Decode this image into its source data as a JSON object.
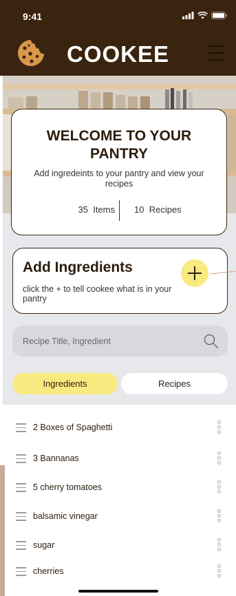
{
  "status_bar": {
    "time": "9:41"
  },
  "header": {
    "title": "COOKEE"
  },
  "welcome": {
    "title": "WELCOME TO YOUR PANTRY",
    "subtitle": "Add ingredeints to your pantry and view your recipes",
    "items_count": "35",
    "items_label": "Items",
    "recipes_count": "10",
    "recipes_label": "Recipes"
  },
  "add_ingredients": {
    "title": "Add Ingredients",
    "subtitle": "click the + to tell cookee what is in your pantry"
  },
  "search": {
    "placeholder": "Recipe Title, Ingredient"
  },
  "tabs": [
    {
      "label": "Ingredients",
      "active": true
    },
    {
      "label": "Recipes",
      "active": false
    }
  ],
  "ingredients": [
    {
      "label": "2 Boxes of Spaghetti"
    },
    {
      "label": "3 Bannanas"
    },
    {
      "label": "5 cherry tomatoes"
    },
    {
      "label": "balsamic vinegar"
    },
    {
      "label": "sugar"
    },
    {
      "label": "cherries"
    }
  ],
  "colors": {
    "brand_brown": "#3a2410",
    "accent_yellow": "#f8ea7f",
    "panel_gray": "#e7e8eb"
  },
  "icons": [
    "cookie-logo-icon",
    "menu-icon",
    "plus-icon",
    "search-icon",
    "drag-handle-icon",
    "more-vertical-icon",
    "signal-icon",
    "wifi-icon",
    "battery-icon"
  ]
}
